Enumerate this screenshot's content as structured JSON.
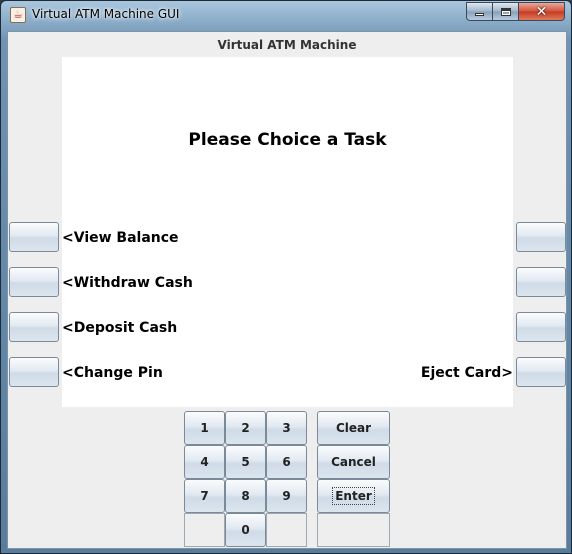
{
  "window": {
    "title": "Virtual ATM Machine GUI",
    "icon": "java-cup-icon",
    "close_glyph": "✕"
  },
  "panel": {
    "heading": "Virtual ATM Machine"
  },
  "screen": {
    "title": "Please Choice a Task",
    "left_options": [
      "<View Balance",
      "<Withdraw Cash",
      "<Deposit Cash",
      "<Change Pin"
    ],
    "right_options": [
      "",
      "",
      "",
      "Eject Card>"
    ]
  },
  "keypad": {
    "digits": [
      "1",
      "2",
      "3",
      "4",
      "5",
      "6",
      "7",
      "8",
      "9",
      "0"
    ],
    "actions": [
      "Clear",
      "Cancel",
      "Enter"
    ]
  },
  "colors": {
    "client_bg": "#eeeeee",
    "screen_bg": "#ffffff",
    "title_bar": "#6e93b3"
  }
}
